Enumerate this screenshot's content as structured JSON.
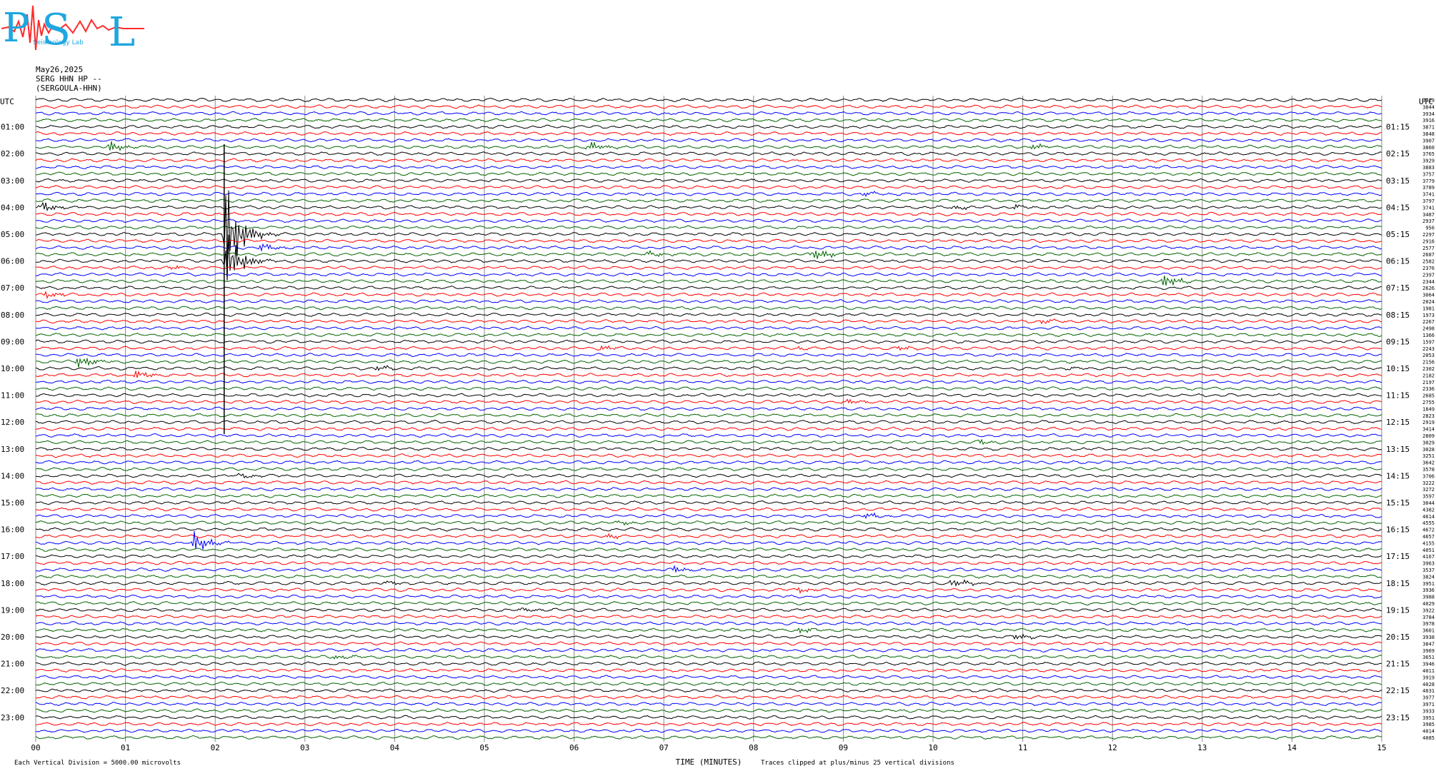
{
  "logo": {
    "text_p": "P",
    "text_s": "S",
    "text_l": "L",
    "text_small": "Seismology Lab"
  },
  "header": {
    "date": "May26,2025",
    "station": "SERG HHN HP --",
    "channel": "(SERGOULA-HHN)"
  },
  "left_axis_label": "UTC",
  "right_axis_label": "UTC",
  "left_hours": [
    "01:00",
    "02:00",
    "03:00",
    "04:00",
    "05:00",
    "06:00",
    "07:00",
    "08:00",
    "09:00",
    "10:00",
    "11:00",
    "12:00",
    "13:00",
    "14:00",
    "15:00",
    "16:00",
    "17:00",
    "18:00",
    "19:00",
    "20:00",
    "21:00",
    "22:00",
    "23:00"
  ],
  "right_hours": [
    "01:15",
    "02:15",
    "03:15",
    "04:15",
    "05:15",
    "06:15",
    "07:15",
    "08:15",
    "09:15",
    "10:15",
    "11:15",
    "12:15",
    "13:15",
    "14:15",
    "15:15",
    "16:15",
    "17:15",
    "18:15",
    "19:15",
    "20:15",
    "21:15",
    "22:15",
    "23:15"
  ],
  "x_ticks": [
    "00",
    "01",
    "02",
    "03",
    "04",
    "05",
    "06",
    "07",
    "08",
    "09",
    "10",
    "11",
    "12",
    "13",
    "14",
    "15"
  ],
  "x_label": "TIME (MINUTES)",
  "footer_left": "Each Vertical Division = 5000.00 microvolts",
  "footer_right": "Traces clipped at plus/minus 25 vertical divisions",
  "trace_colors": [
    "#000000",
    "#ff0000",
    "#0000ff",
    "#006400"
  ],
  "rms_values": [
    "3929",
    "3844",
    "3934",
    "3916",
    "3871",
    "3848",
    "3907",
    "3860",
    "3765",
    "3929",
    "3883",
    "3757",
    "3779",
    "3789",
    "3741",
    "3797",
    "3741",
    "3487",
    "2937",
    "956",
    "2297",
    "2916",
    "2577",
    "2687",
    "2582",
    "2376",
    "2397",
    "2344",
    "2626",
    "3064",
    "2024",
    "1981",
    "1973",
    "2267",
    "2498",
    "1366",
    "1597",
    "2243",
    "2053",
    "2156",
    "2302",
    "2182",
    "2197",
    "2336",
    "2685",
    "2755",
    "1849",
    "2823",
    "2919",
    "3414",
    "2809",
    "3029",
    "3028",
    "3251",
    "3642",
    "3578",
    "3706",
    "3222",
    "3272",
    "3597",
    "3044",
    "4382",
    "4614",
    "4555",
    "4672",
    "4657",
    "4155",
    "4051",
    "4167",
    "3963",
    "3537",
    "3824",
    "3951",
    "3936",
    "3988",
    "4029",
    "3922",
    "3784",
    "3978",
    "3601",
    "3938",
    "3847",
    "3969",
    "3651",
    "3946",
    "4011",
    "3919",
    "4028",
    "4031",
    "3977",
    "3971",
    "3933",
    "3951",
    "3985",
    "4014",
    "4085"
  ],
  "chart_data": {
    "type": "line",
    "title": "SERG HHN HP --",
    "xlabel": "TIME (MINUTES)",
    "ylabel": "UTC",
    "xlim": [
      0,
      15
    ],
    "trace_count": 96,
    "minutes_per_trace": 15,
    "events": [
      {
        "trace": 7,
        "minute": 0.8,
        "amp": 8,
        "color": "blue"
      },
      {
        "trace": 7,
        "minute": 6.15,
        "amp": 6,
        "color": "red"
      },
      {
        "trace": 7,
        "minute": 11.1,
        "amp": 4,
        "color": "red"
      },
      {
        "trace": 14,
        "minute": 9.2,
        "amp": 3,
        "color": "green"
      },
      {
        "trace": 16,
        "minute": 0.05,
        "amp": 7,
        "color": "blue"
      },
      {
        "trace": 16,
        "minute": 10.2,
        "amp": 3,
        "color": "blue"
      },
      {
        "trace": 16,
        "minute": 10.9,
        "amp": 3,
        "color": "blue"
      },
      {
        "trace": 20,
        "minute": 2.1,
        "amp": 70,
        "color": "black"
      },
      {
        "trace": 22,
        "minute": 2.5,
        "amp": 5,
        "color": "blue"
      },
      {
        "trace": 23,
        "minute": 6.8,
        "amp": 4,
        "color": "black"
      },
      {
        "trace": 23,
        "minute": 8.65,
        "amp": 8,
        "color": "green"
      },
      {
        "trace": 24,
        "minute": 2.1,
        "amp": 40,
        "color": "black"
      },
      {
        "trace": 25,
        "minute": 1.5,
        "amp": 3,
        "color": "red"
      },
      {
        "trace": 27,
        "minute": 12.55,
        "amp": 9,
        "color": "black"
      },
      {
        "trace": 29,
        "minute": 0.1,
        "amp": 4,
        "color": "blue"
      },
      {
        "trace": 33,
        "minute": 11.2,
        "amp": 3,
        "color": "blue"
      },
      {
        "trace": 37,
        "minute": 6.3,
        "amp": 4,
        "color": "red"
      },
      {
        "trace": 37,
        "minute": 8.5,
        "amp": 2,
        "color": "red"
      },
      {
        "trace": 37,
        "minute": 9.6,
        "amp": 3,
        "color": "red"
      },
      {
        "trace": 39,
        "minute": 0.45,
        "amp": 9,
        "color": "green"
      },
      {
        "trace": 40,
        "minute": 3.8,
        "amp": 3,
        "color": "black"
      },
      {
        "trace": 40,
        "minute": 11.5,
        "amp": 2,
        "color": "black"
      },
      {
        "trace": 41,
        "minute": 1.1,
        "amp": 6,
        "color": "red"
      },
      {
        "trace": 45,
        "minute": 9.0,
        "amp": 5,
        "color": "red"
      },
      {
        "trace": 51,
        "minute": 10.5,
        "amp": 3,
        "color": "green"
      },
      {
        "trace": 56,
        "minute": 2.25,
        "amp": 3,
        "color": "black"
      },
      {
        "trace": 62,
        "minute": 9.25,
        "amp": 4,
        "color": "blue"
      },
      {
        "trace": 63,
        "minute": 6.5,
        "amp": 3,
        "color": "green"
      },
      {
        "trace": 65,
        "minute": 6.35,
        "amp": 3,
        "color": "red"
      },
      {
        "trace": 66,
        "minute": 1.75,
        "amp": 14,
        "color": "blue"
      },
      {
        "trace": 70,
        "minute": 7.1,
        "amp": 4,
        "color": "blue"
      },
      {
        "trace": 72,
        "minute": 3.9,
        "amp": 2,
        "color": "black"
      },
      {
        "trace": 72,
        "minute": 10.2,
        "amp": 7,
        "color": "black"
      },
      {
        "trace": 73,
        "minute": 8.5,
        "amp": 3,
        "color": "red"
      },
      {
        "trace": 76,
        "minute": 5.4,
        "amp": 3,
        "color": "black"
      },
      {
        "trace": 79,
        "minute": 8.5,
        "amp": 4,
        "color": "green"
      },
      {
        "trace": 80,
        "minute": 10.9,
        "amp": 4,
        "color": "black"
      },
      {
        "trace": 83,
        "minute": 3.3,
        "amp": 3,
        "color": "green"
      }
    ]
  }
}
